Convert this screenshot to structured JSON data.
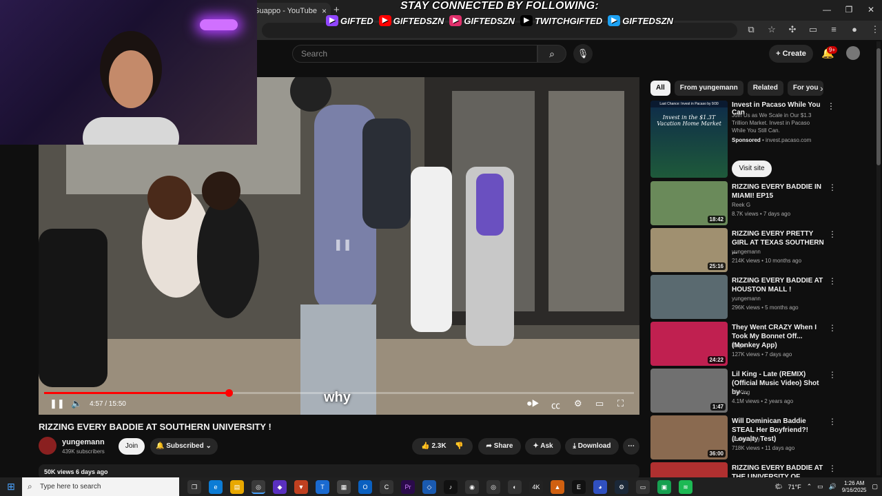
{
  "browser": {
    "tab_title": "Guappo - YouTube",
    "tab_close": "×",
    "new_tab": "+",
    "win_minimize": "—",
    "win_restore": "❐",
    "win_close": "✕"
  },
  "overlay": {
    "title": "STAY CONNECTED BY FOLLOWING:",
    "socials": [
      {
        "icon": "twitch-icon",
        "label": "GIFTED",
        "color": "#9146ff"
      },
      {
        "icon": "youtube-icon",
        "label": "GIFTEDSZN",
        "color": "#ff0000"
      },
      {
        "icon": "instagram-icon",
        "label": "GIFTEDSZN",
        "color": "#e1306c"
      },
      {
        "icon": "tiktok-icon",
        "label": "TWITCHGIFTED",
        "color": "#000000"
      },
      {
        "icon": "twitter-icon",
        "label": "GIFTEDSZN",
        "color": "#1da1f2"
      }
    ]
  },
  "header": {
    "search_placeholder": "Search",
    "create_label": "Create",
    "notif_count": "9+"
  },
  "player": {
    "caption": "why",
    "time": "4:57 / 15:50",
    "progress": 0.313
  },
  "video": {
    "title": "RIZZING EVERY BADDIE AT SOUTHERN UNIVERSITY !",
    "channel": "yungemann",
    "subscribers": "439K subscribers",
    "join_label": "Join",
    "subscribed_label": "Subscribed",
    "likes": "2.3K",
    "share_label": "Share",
    "ask_label": "Ask",
    "download_label": "Download",
    "views_line": "50K views  6 days ago"
  },
  "sidebar": {
    "chips": [
      "All",
      "From yungemann",
      "Related",
      "For you"
    ],
    "ad": {
      "thumb_badge": "Last Chance: Invest in Pacaso by 9/30",
      "thumb_text": "Invest in the $1.3T Vacation Home Market",
      "title": "Invest in Pacaso While You Can",
      "desc": "Join Us as We Scale in Our $1.3 Trillion Market. Invest in Pacaso While You Still Can.",
      "sponsored": "Sponsored",
      "domain": " • invest.pacaso.com",
      "cta": "Visit site"
    },
    "videos": [
      {
        "title": "RIZZING EVERY BADDIE IN MIAMI! EP15",
        "channel": "Reek G",
        "meta": "8.7K views • 7 days ago",
        "duration": "18:42",
        "thumb": "#6a8a5a"
      },
      {
        "title": "RIZZING EVERY PRETTY GIRL AT TEXAS SOUTHERN ...",
        "channel": "yungemann",
        "meta": "214K views • 10 months ago",
        "duration": "25:16",
        "thumb": "#a09070"
      },
      {
        "title": "RIZZING EVERY BADDIE AT HOUSTON MALL !",
        "channel": "yungemann",
        "meta": "296K views • 5 months ago",
        "duration": "",
        "thumb": "#5a6a70"
      },
      {
        "title": "They Went CRAZY When I Took My Bonnet Off... (Monkey App)",
        "channel": "Teige",
        "meta": "127K views • 7 days ago",
        "duration": "24:22",
        "thumb": "#c02050"
      },
      {
        "title": "Lil King - Late  (REMIX) (Official Music Video) Shot by ...",
        "channel": "Lil King",
        "meta": "4.1M views • 2 years ago",
        "duration": "1:47",
        "thumb": "#707070"
      },
      {
        "title": "Will Dominican Baddie STEAL Her Boyfriend?! (Loyalty Test)",
        "channel": "soulessjayy",
        "meta": "718K views • 11 days ago",
        "duration": "36:00",
        "thumb": "#8a6a50"
      },
      {
        "title": "RIZZING EVERY BADDIE AT THE UNIVERSITY OF GEORGIA !",
        "channel": "",
        "meta": "",
        "duration": "",
        "thumb": "#b03030"
      }
    ]
  },
  "taskbar": {
    "search_placeholder": "Type here to search",
    "temperature": "71°F",
    "time": "1:26 AM",
    "date": "9/16/2025"
  }
}
